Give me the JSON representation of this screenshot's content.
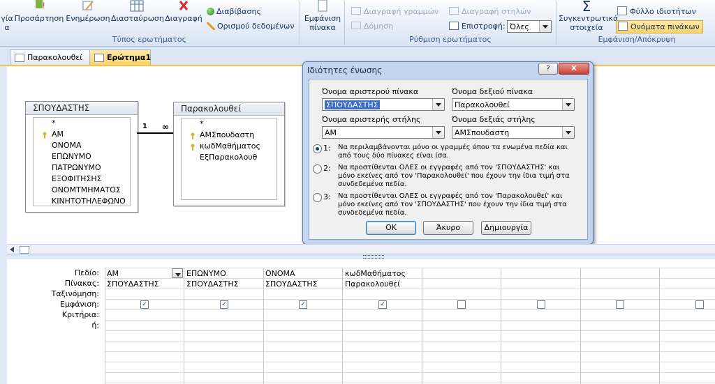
{
  "ribbon": {
    "cut_left_label": "γία\nα",
    "append_label": "Προσάρτηση",
    "update_label": "Ενημέρωση",
    "crosstab_label": "Διασταύρωση",
    "delete_label": "Διαγραφή",
    "pass_through_label": "Διαβίβασης",
    "data_definition_label": "Ορισμού δεδομένων",
    "query_type_group": "Τύπος ερωτήματος",
    "show_table_label": "Εμφάνιση\nπίνακα",
    "delete_rows_label": "Διαγραφή γραμμών",
    "builder_label": "Δόμηση",
    "delete_columns_label": "Διαγραφή στηλών",
    "return_label": "Επιστροφή:",
    "return_value": "Όλες",
    "query_setup_group": "Ρύθμιση ερωτήματος",
    "totals_label": "Συγκεντρωτικά\nστοιχεία",
    "property_sheet_label": "Φύλλο ιδιοτήτων",
    "table_names_label": "Ονόματα πινάκων",
    "show_hide_group": "Εμφάνιση/Απόκρυψη"
  },
  "tabs": [
    {
      "label": "Παρακολουθεί"
    },
    {
      "label": "Ερώτημα1"
    }
  ],
  "tables": {
    "students": {
      "title": "ΣΠΟΥΔΑΣΤΗΣ",
      "fields": [
        "*",
        "ΑΜ",
        "ΟΝΟΜΑ",
        "ΕΠΩΝΥΜΟ",
        "ΠΑΤΡΩΝΥΜΟ",
        "ΕΞΟΦΙΤΗΣΗΣ",
        "ΟΝΟΜΤΜΗΜΑΤΟΣ",
        "ΚΙΝΗΤΟΤΗΛΕΦΩΝΟ"
      ]
    },
    "attends": {
      "title": "Παρακολουθεί",
      "fields": [
        "*",
        "ΑΜΣπουδαστη",
        "κωδΜαθήματος",
        "ΕξΠαρακολουθ"
      ]
    },
    "relation": {
      "left": "1",
      "right": "∞"
    }
  },
  "dialog": {
    "title": "Ιδιότητες ένωσης",
    "left_table_label": "Όνομα αριστερού πίνακα",
    "left_table_value": "ΣΠΟΥΔΑΣΤΗΣ",
    "right_table_label": "Όνομα δεξιού πίνακα",
    "right_table_value": "Παρακολουθεί",
    "left_column_label": "Όνομα αριστερής στήλης",
    "left_column_value": "ΑΜ",
    "right_column_label": "Όνομα δεξιάς στήλης",
    "right_column_value": "ΑΜΣπουδαστη",
    "options": [
      {
        "num": "1:",
        "text": "Να περιλαμβάνονται μόνο οι γραμμές όπου τα ενωμένα πεδία και από τους δύο πίνακες είναι ίσα.",
        "selected": true
      },
      {
        "num": "2:",
        "text": "Να προστίθενται ΟΛΕΣ οι εγγραφές από τον 'ΣΠΟΥΔΑΣΤΗΣ' και μόνο εκείνες από τον 'Παρακολουθεί' που έχουν την ίδια τιμή στα συνδεδεμένα πεδία.",
        "selected": false
      },
      {
        "num": "3:",
        "text": "Να προστίθενται ΟΛΕΣ οι εγγραφές από τον 'Παρακολουθεί' και μόνο εκείνες από τον 'ΣΠΟΥΔΑΣΤΗΣ' που έχουν την ίδια τιμή στα συνδεδεμένα πεδία.",
        "selected": false
      }
    ],
    "ok_label": "OK",
    "cancel_label": "Άκυρο",
    "new_label": "Δημιουργία",
    "help_label": "?",
    "close_label": "X"
  },
  "grid": {
    "row_labels": [
      "Πεδίο:",
      "Πίνακας:",
      "Ταξινόμηση:",
      "Εμφάνιση:",
      "Κριτήρια:",
      "ή:"
    ],
    "columns": [
      {
        "field": "ΑΜ",
        "table": "ΣΠΟΥΔΑΣΤΗΣ",
        "show": true
      },
      {
        "field": "ΕΠΩΝΥΜΟ",
        "table": "ΣΠΟΥΔΑΣΤΗΣ",
        "show": true
      },
      {
        "field": "ΟΝΟΜΑ",
        "table": "ΣΠΟΥΔΑΣΤΗΣ",
        "show": true
      },
      {
        "field": "κωδΜαθήματος",
        "table": "Παρακολουθεί",
        "show": true
      },
      {
        "field": "",
        "table": "",
        "show": false
      },
      {
        "field": "",
        "table": "",
        "show": false
      },
      {
        "field": "",
        "table": "",
        "show": false
      },
      {
        "field": "",
        "table": "",
        "show": false
      }
    ]
  },
  "colors": {
    "accent": "#fcd46a",
    "dialog_frame": "#c3d5ee",
    "close_red": "#c8413a"
  }
}
